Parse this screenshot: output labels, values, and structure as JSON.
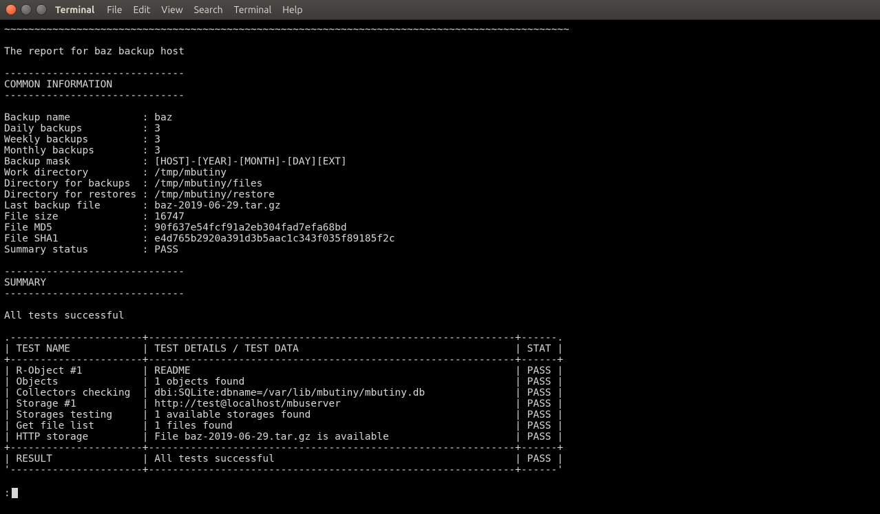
{
  "window": {
    "app_name": "Terminal",
    "menu": [
      "File",
      "Edit",
      "View",
      "Search",
      "Terminal",
      "Help"
    ]
  },
  "report": {
    "tilde_sep": "~~~~~~~~~~~~~~~~~~~~~~~~~~~~~~~~~~~~~~~~~~~~~~~~~~~~~~~~~~~~~~~~~~~~~~~~~~~~~~~~~~~~~~~~~~~~~~",
    "title": "The report for baz backup host",
    "dash_sep": "------------------------------",
    "section_common": "COMMON INFORMATION",
    "common": [
      [
        "Backup name",
        "baz"
      ],
      [
        "Daily backups",
        "3"
      ],
      [
        "Weekly backups",
        "3"
      ],
      [
        "Monthly backups",
        "3"
      ],
      [
        "Backup mask",
        "[HOST]-[YEAR]-[MONTH]-[DAY][EXT]"
      ],
      [
        "Work directory",
        "/tmp/mbutiny"
      ],
      [
        "Directory for backups",
        "/tmp/mbutiny/files"
      ],
      [
        "Directory for restores",
        "/tmp/mbutiny/restore"
      ],
      [
        "Last backup file",
        "baz-2019-06-29.tar.gz"
      ],
      [
        "File size",
        "16747"
      ],
      [
        "File MD5",
        "90f637e54fcf91a2eb304fad7efa68bd"
      ],
      [
        "File SHA1",
        "e4d765b2920a391d3b5aac1c343f035f89185f2c"
      ],
      [
        "Summary status",
        "PASS"
      ]
    ],
    "section_summary": "SUMMARY",
    "all_tests": "All tests successful",
    "table_border": ".----------------------+-------------------------------------------------------------+------.",
    "table_header": [
      "TEST NAME",
      "TEST DETAILS / TEST DATA",
      "STAT"
    ],
    "table_sep": "+----------------------+-------------------------------------------------------------+------+",
    "tests": [
      [
        "R-Object #1",
        "README",
        "PASS"
      ],
      [
        "Objects",
        "1 objects found",
        "PASS"
      ],
      [
        "Collectors checking",
        "dbi:SQLite:dbname=/var/lib/mbutiny/mbutiny.db",
        "PASS"
      ],
      [
        "Storage #1",
        "http://test@localhost/mbuserver",
        "PASS"
      ],
      [
        "Storages testing",
        "1 available storages found",
        "PASS"
      ],
      [
        "Get file list",
        "1 files found",
        "PASS"
      ],
      [
        "HTTP storage",
        "File baz-2019-06-29.tar.gz is available",
        "PASS"
      ]
    ],
    "result_row": [
      "RESULT",
      "All tests successful",
      "PASS"
    ],
    "table_bottom": "'----------------------+-------------------------------------------------------------+------'",
    "prompt": ":"
  }
}
